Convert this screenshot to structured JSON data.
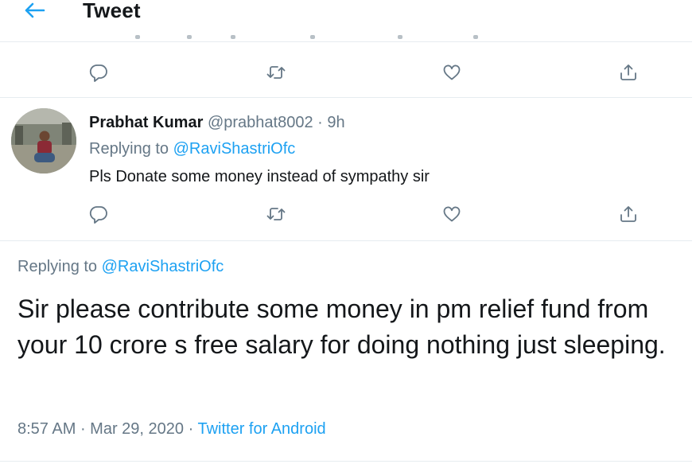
{
  "header": {
    "title": "Tweet"
  },
  "reply": {
    "name": "Prabhat Kumar",
    "handle": "@prabhat8002",
    "separator": "·",
    "time": "9h",
    "replying_prefix": "Replying to ",
    "replying_handle": "@RaviShastriOfc",
    "text": "Pls Donate some money instead of sympathy sir"
  },
  "main_tweet": {
    "replying_prefix": "Replying to ",
    "replying_handle": "@RaviShastriOfc",
    "text": "Sir please contribute some money in pm relief fund from your 10 crore s free salary for doing nothing just sleeping.",
    "time": "8:57 AM",
    "sep1": " · ",
    "date": "Mar 29, 2020",
    "sep2": " · ",
    "source": "Twitter for Android"
  },
  "icons": [
    "back-arrow-icon",
    "reply-icon",
    "retweet-icon",
    "like-icon",
    "share-icon"
  ],
  "colors": {
    "accent": "#1da1f2",
    "text": "#14171a",
    "secondary": "#657786",
    "border": "#e6ecf0"
  }
}
